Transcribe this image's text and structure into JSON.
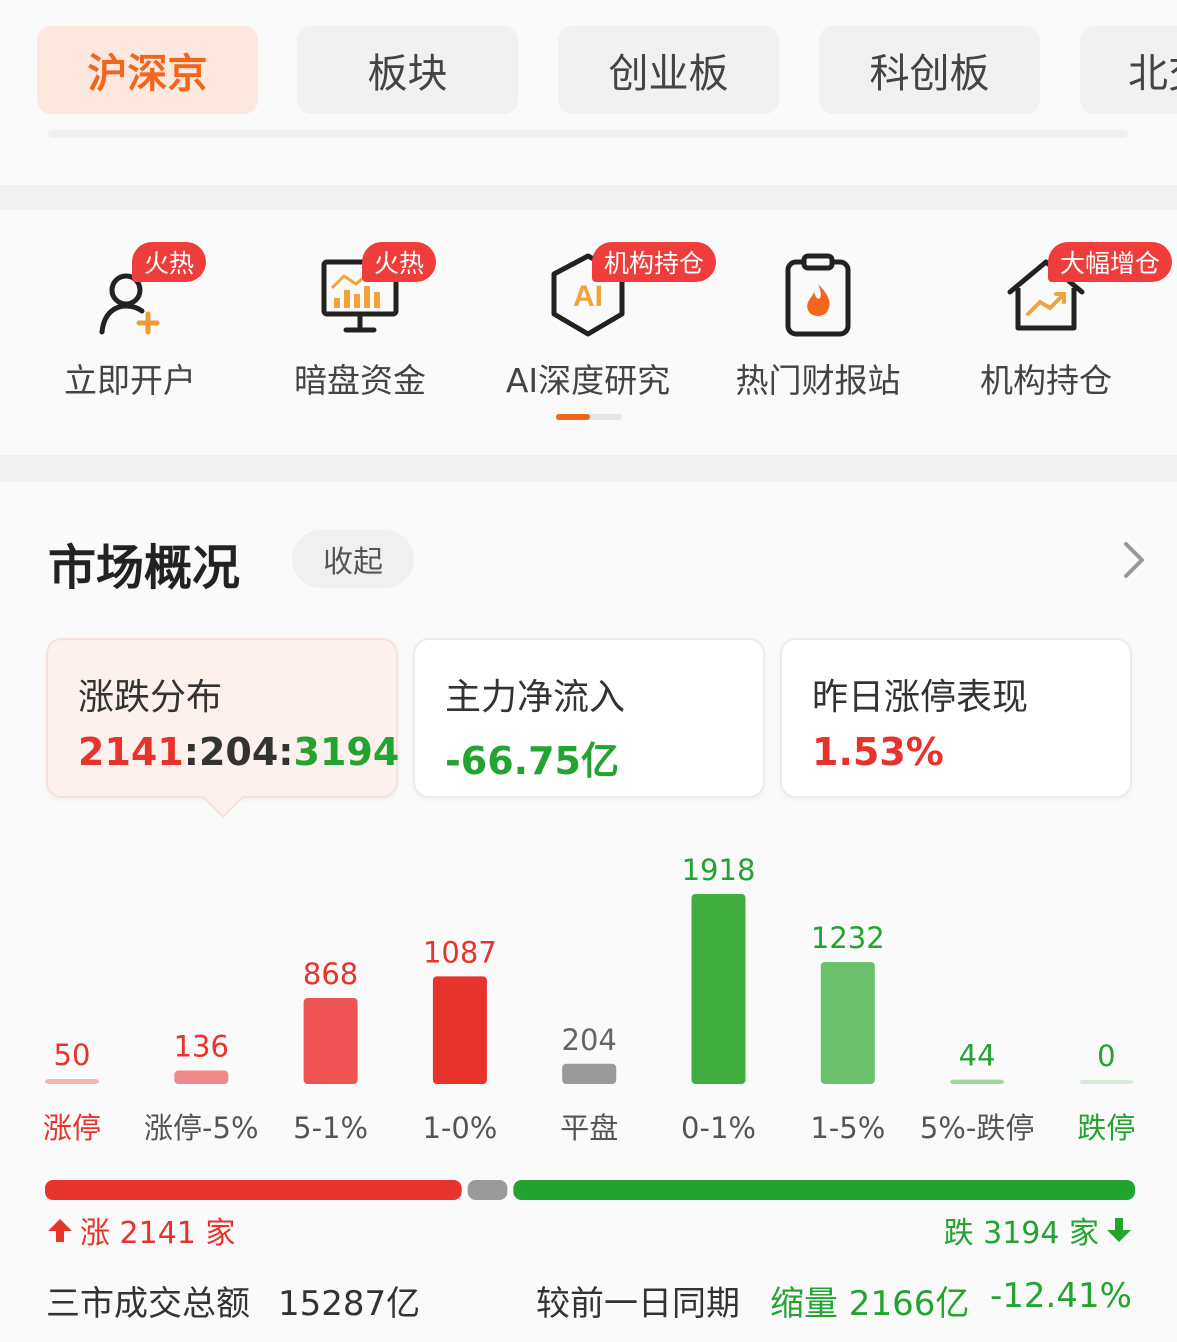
{
  "market_tabs": [
    {
      "label": "沪深京",
      "active": true
    },
    {
      "label": "板块",
      "active": false
    },
    {
      "label": "创业板",
      "active": false
    },
    {
      "label": "科创板",
      "active": false
    },
    {
      "label": "北交",
      "active": false
    }
  ],
  "quick_entries": [
    {
      "label": "立即开户",
      "icon": "user-add-icon",
      "badge": "火热"
    },
    {
      "label": "暗盘资金",
      "icon": "monitor-chart-icon",
      "badge": "火热"
    },
    {
      "label": "AI深度研究",
      "icon": "ai-hexagon-icon",
      "badge": "机构持仓"
    },
    {
      "label": "热门财报站",
      "icon": "clipboard-fire-icon",
      "badge": ""
    },
    {
      "label": "机构持仓",
      "icon": "house-trend-icon",
      "badge": "大幅增仓"
    }
  ],
  "overview": {
    "title": "市场概况",
    "collapse_label": "收起",
    "cards": [
      {
        "label": "涨跌分布",
        "value_up": "2141",
        "sep1": ":",
        "value_flat": "204",
        "sep2": ":",
        "value_down": "3194"
      },
      {
        "label": "主力净流入",
        "value": "-66.75亿"
      },
      {
        "label": "昨日涨停表现",
        "value": "1.53%"
      }
    ],
    "ratio": {
      "up_label": "涨 2141 家",
      "down_label": "跌 3194 家",
      "up": 2141,
      "flat": 204,
      "down": 3194
    },
    "volume": {
      "label": "三市成交总额",
      "amount": "15287亿",
      "compare_label": "较前一日同期",
      "change_label": "缩量 2166亿",
      "change_pct": "-12.41%"
    }
  },
  "colors": {
    "accent": "#f2661c",
    "up_red": "#e8322c",
    "down_green": "#23a430",
    "flat_gray": "#9a9a9a"
  },
  "chart_data": {
    "type": "bar",
    "categories": [
      "涨停",
      "涨停-5%",
      "5-1%",
      "1-0%",
      "平盘",
      "0-1%",
      "1-5%",
      "5%-跌停",
      "跌停"
    ],
    "values": [
      50,
      136,
      868,
      1087,
      204,
      1918,
      1232,
      44,
      0
    ],
    "bar_colors": [
      "#f6b5b5",
      "#f08a8a",
      "#ef5454",
      "#e8322c",
      "#9a9a9a",
      "#3fae3f",
      "#6cc26c",
      "#9ed89e",
      "#d6ecd6"
    ],
    "label_colors": [
      "#e8322c",
      "#555555",
      "#555555",
      "#555555",
      "#555555",
      "#555555",
      "#555555",
      "#555555",
      "#23a430"
    ],
    "value_colors": [
      "#e8322c",
      "#e8322c",
      "#e8322c",
      "#e8322c",
      "#666666",
      "#23a430",
      "#23a430",
      "#23a430",
      "#23a430"
    ],
    "title": "",
    "xlabel": "",
    "ylabel": "",
    "ylim": [
      0,
      1918
    ],
    "grid": false
  }
}
